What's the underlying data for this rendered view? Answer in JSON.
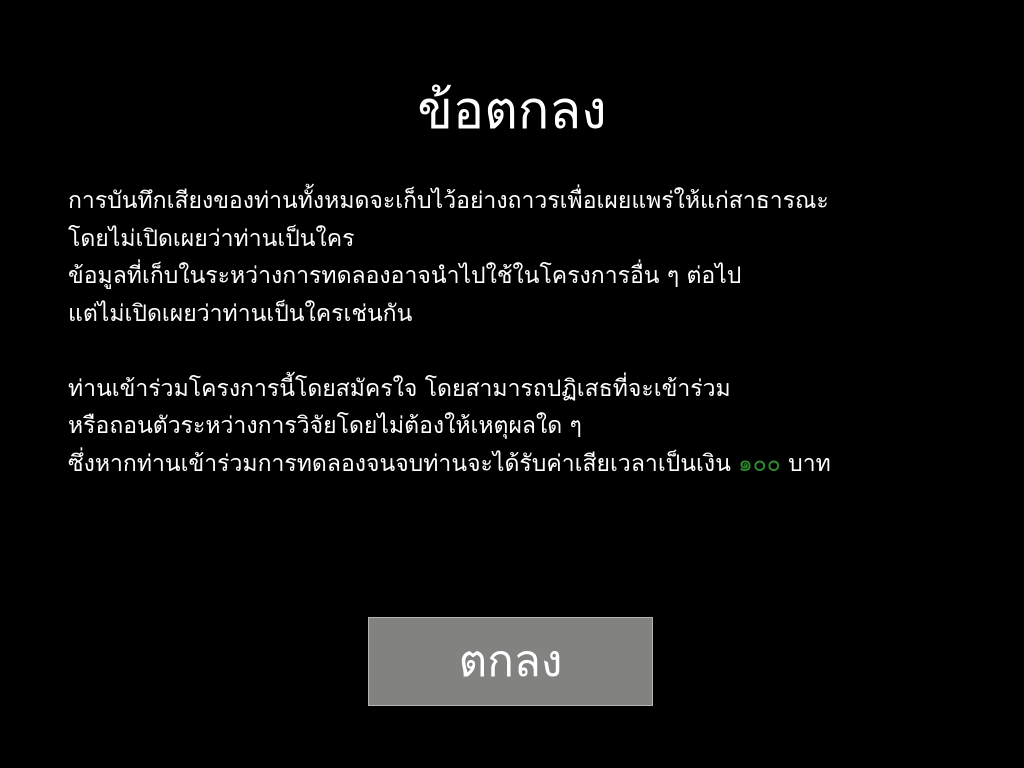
{
  "colors": {
    "background": "#000000",
    "text": "#ffffff",
    "amount_highlight": "#2e8b2e",
    "button_bg": "#828380"
  },
  "dialog": {
    "title": "ข้อตกลง",
    "paragraph1": {
      "lines": [
        "การบันทึกเสียงของท่านทั้งหมดจะเก็บไว้อย่างถาวรเพื่อเผยแพร่ให้แก่สาธารณะ",
        "โดยไม่เปิดเผยว่าท่านเป็นใคร",
        "ข้อมูลที่เก็บในระหว่างการทดลองอาจนำไปใช้ในโครงการอื่น ๆ ต่อไป",
        "แต่ไม่เปิดเผยว่าท่านเป็นใครเช่นกัน"
      ]
    },
    "paragraph2": {
      "lines": [
        "ท่านเข้าร่วมโครงการนี้โดยสมัครใจ โดยสามารถปฏิเสธที่จะเข้าร่วม",
        "หรือถอนตัวระหว่างการวิจัยโดยไม่ต้องให้เหตุผลใด ๆ"
      ],
      "last_line_prefix": "ซึ่งหากท่านเข้าร่วมการทดลองจนจบท่านจะได้รับค่าเสียเวลาเป็นเงิน",
      "amount": "๑๐๐",
      "currency": "บาท"
    },
    "ok_button_label": "ตกลง"
  }
}
